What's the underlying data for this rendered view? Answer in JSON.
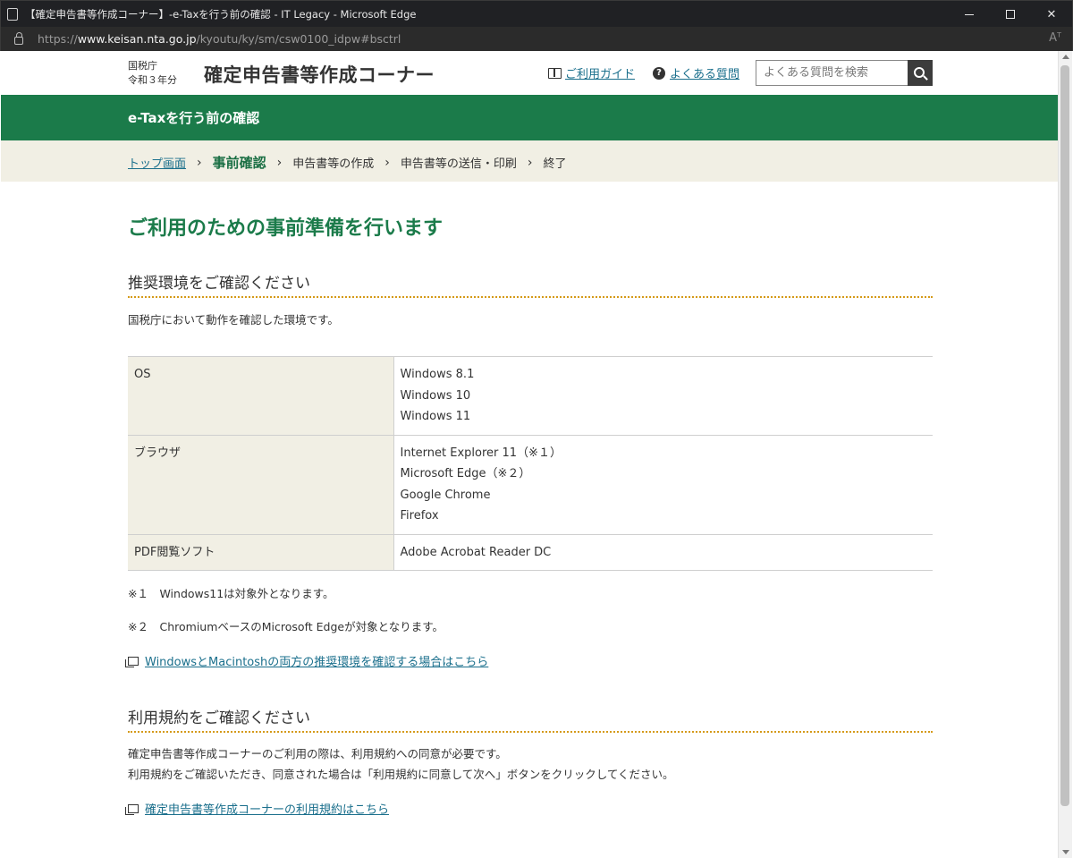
{
  "window": {
    "title": "【確定申告書等作成コーナー】-e-Taxを行う前の確認 - IT Legacy - Microsoft Edge"
  },
  "address_bar": {
    "url_prefix": "https://",
    "url_host": "www.keisan.nta.go.jp",
    "url_path": "/kyoutu/ky/sm/csw0100_idpw#bsctrl",
    "read_aloud_label": "Aᵀ"
  },
  "header": {
    "agency": "国税庁",
    "year": "令和３年分",
    "site_title": "確定申告書等作成コーナー",
    "guide_link": "ご利用ガイド",
    "faq_link": "よくある質問",
    "faq_icon_char": "?",
    "search_placeholder": "よくある質問を検索"
  },
  "band": {
    "title": "e-Taxを行う前の確認"
  },
  "breadcrumb": {
    "home": "トップ画面",
    "sep": "›",
    "current": "事前確認",
    "steps": [
      "申告書等の作成",
      "申告書等の送信・印刷",
      "終了"
    ]
  },
  "main": {
    "page_title": "ご利用のための事前準備を行います",
    "section1": {
      "heading": "推奨環境をご確認ください",
      "intro": "国税庁において動作を確認した環境です。",
      "table": [
        {
          "label": "OS",
          "values": [
            "Windows 8.1",
            "Windows 10",
            "Windows 11"
          ]
        },
        {
          "label": "ブラウザ",
          "values": [
            "Internet Explorer 11（※１）",
            "Microsoft Edge（※２）",
            "Google Chrome",
            "Firefox"
          ]
        },
        {
          "label": "PDF閲覧ソフト",
          "values": [
            "Adobe Acrobat Reader DC"
          ]
        }
      ],
      "note1": "※１　Windows11は対象外となります。",
      "note2": "※２　ChromiumベースのMicrosoft Edgeが対象となります。",
      "link": "WindowsとMacintoshの両方の推奨環境を確認する場合はこちら"
    },
    "section2": {
      "heading": "利用規約をご確認ください",
      "line1": "確定申告書等作成コーナーのご利用の際は、利用規約への同意が必要です。",
      "line2": "利用規約をご確認いただき、同意された場合は「利用規約に同意して次へ」ボタンをクリックしてください。",
      "link": "確定申告書等作成コーナーの利用規約はこちら"
    }
  },
  "colors": {
    "brand_green": "#1b7b4a",
    "link_blue": "#1a6f8c",
    "beige": "#f1efe4",
    "dotted_orange": "#d59a18"
  }
}
